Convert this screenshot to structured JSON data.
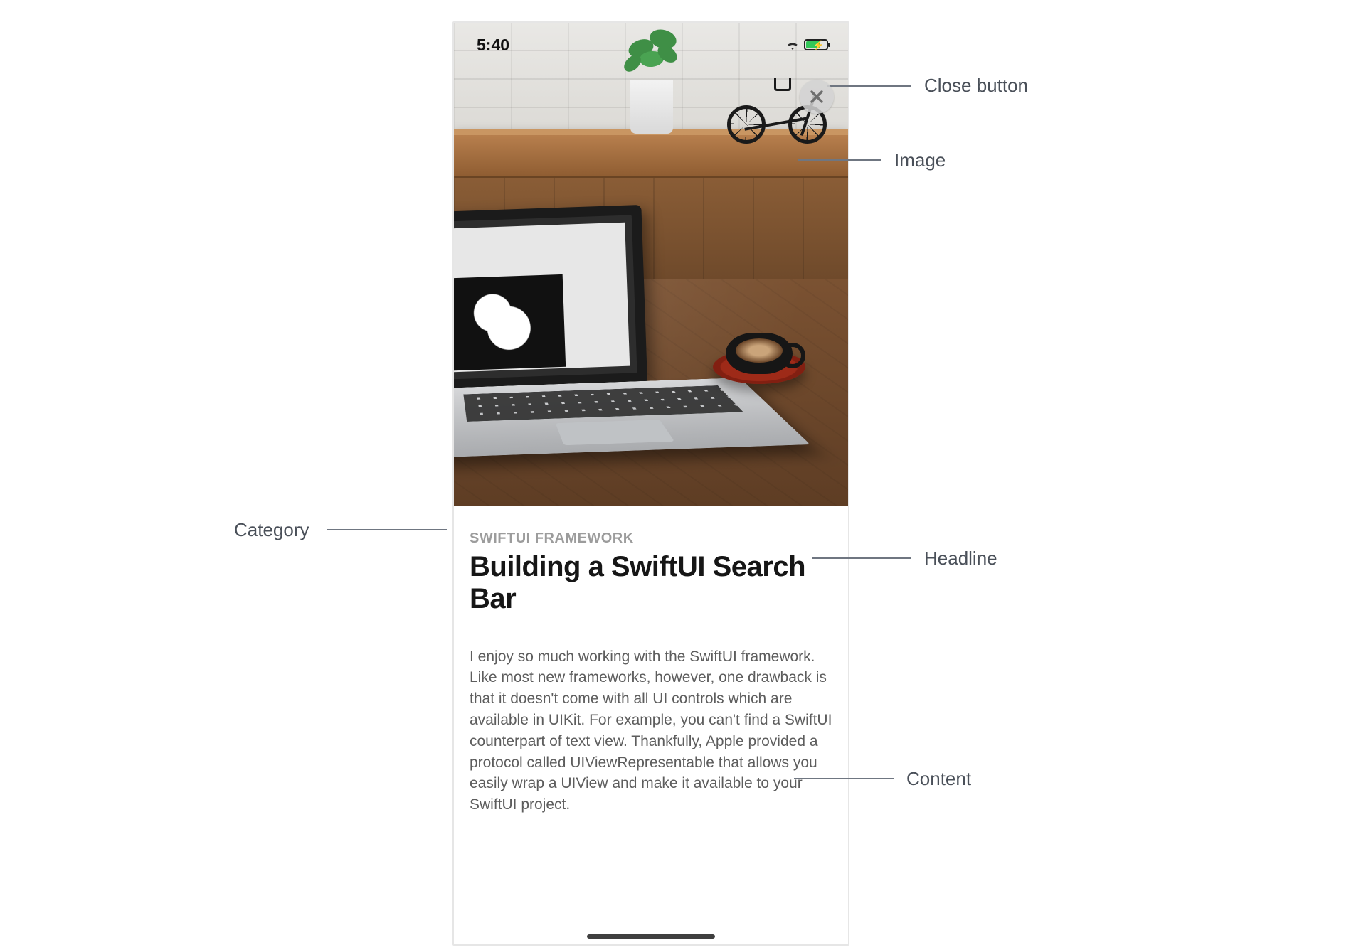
{
  "status_bar": {
    "time": "5:40"
  },
  "close_button": {
    "glyph": "✕"
  },
  "article": {
    "category": "SWIFTUI FRAMEWORK",
    "headline": "Building a SwiftUI Search Bar",
    "content": "I enjoy so much working with the SwiftUI framework. Like most new frameworks, however, one drawback is that it doesn't come with all UI controls which are available in UIKit. For example, you can't find a SwiftUI counterpart of text view. Thankfully, Apple provided a protocol called UIViewRepresentable that allows you easily wrap a UIView and make it available to your SwiftUI project."
  },
  "annotations": {
    "close_button": "Close button",
    "image": "Image",
    "category": "Category",
    "headline": "Headline",
    "content": "Content"
  }
}
